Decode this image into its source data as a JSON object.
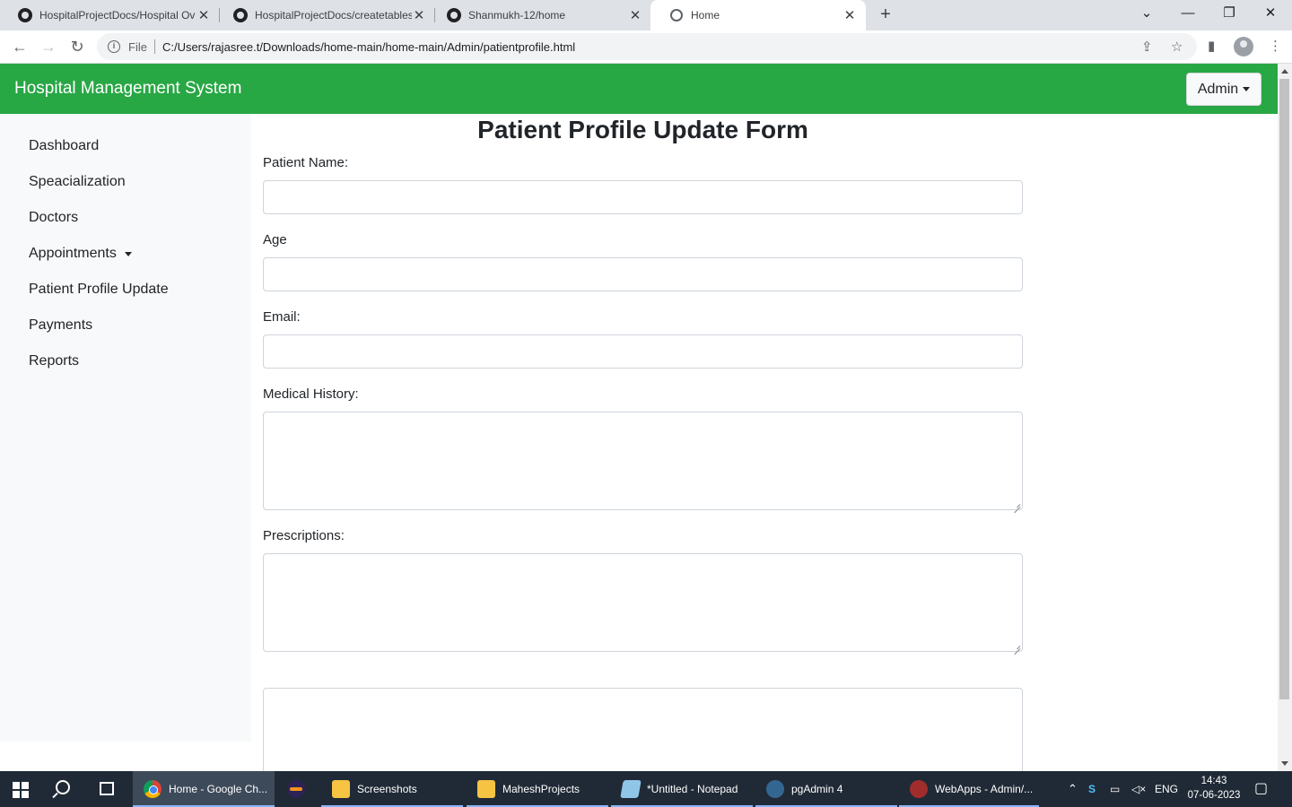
{
  "browser": {
    "tabs": [
      {
        "title": "HospitalProjectDocs/Hospital Ov",
        "active": false
      },
      {
        "title": "HospitalProjectDocs/createtables",
        "active": false
      },
      {
        "title": "Shanmukh-12/home",
        "active": false
      },
      {
        "title": "Home",
        "active": true
      }
    ],
    "address": {
      "scheme_label": "File",
      "url": "C:/Users/rajasree.t/Downloads/home-main/home-main/Admin/patientprofile.html"
    }
  },
  "app": {
    "brand": "Hospital Management System",
    "user_menu": "Admin",
    "accent_color": "#28a745"
  },
  "sidebar": {
    "items": [
      {
        "label": "Dashboard"
      },
      {
        "label": "Speacialization"
      },
      {
        "label": "Doctors"
      },
      {
        "label": "Appointments",
        "dropdown": true
      },
      {
        "label": "Patient Profile Update"
      },
      {
        "label": "Payments"
      },
      {
        "label": "Reports"
      }
    ]
  },
  "form": {
    "title": "Patient Profile Update Form",
    "fields": [
      {
        "label": "Patient Name:",
        "value": "",
        "type": "text"
      },
      {
        "label": "Age",
        "value": "",
        "type": "text"
      },
      {
        "label": "Email:",
        "value": "",
        "type": "text"
      },
      {
        "label": "Medical History:",
        "value": "",
        "type": "textarea"
      },
      {
        "label": "Prescriptions:",
        "value": "",
        "type": "textarea"
      }
    ]
  },
  "taskbar": {
    "items": [
      {
        "label": "Home - Google Ch...",
        "icon": "chrome-icon",
        "active": true
      },
      {
        "label": "",
        "icon": "eclipse-icon"
      },
      {
        "label": "Screenshots",
        "icon": "folder-icon"
      },
      {
        "label": "MaheshProjects",
        "icon": "folder-icon"
      },
      {
        "label": "*Untitled - Notepad",
        "icon": "notepad-icon"
      },
      {
        "label": "pgAdmin 4",
        "icon": "pgadmin-icon"
      },
      {
        "label": "WebApps - Admin/...",
        "icon": "webapps-icon"
      }
    ],
    "language": "ENG",
    "time": "14:43",
    "date": "07-06-2023"
  }
}
